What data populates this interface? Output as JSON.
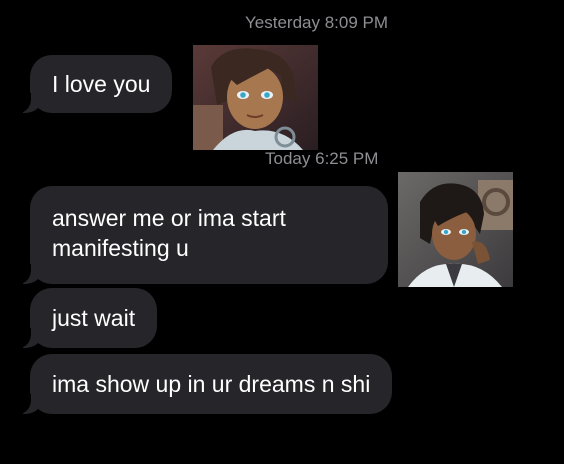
{
  "conversation": {
    "timestamps": [
      {
        "day": "Yesterday",
        "time": "8:09 PM"
      },
      {
        "day": "Today",
        "time": "6:25 PM"
      }
    ],
    "messages": [
      {
        "text": "I love you"
      },
      {
        "text": "answer me or ima start manifesting u"
      },
      {
        "text": "just wait"
      },
      {
        "text": "ima show up in ur dreams n shi"
      }
    ]
  },
  "colors": {
    "background": "#000000",
    "incoming_bubble": "#26252a",
    "message_text": "#ffffff",
    "timestamp_text": "#8e8e93"
  }
}
